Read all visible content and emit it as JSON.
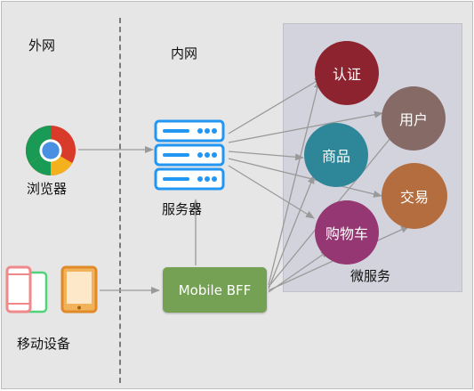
{
  "zones": {
    "external": "外网",
    "internal": "内网"
  },
  "clients": {
    "browser": "浏览器",
    "mobile": "移动设备"
  },
  "server": {
    "label": "服务器"
  },
  "bff": {
    "label": "Mobile BFF"
  },
  "microservices": {
    "label": "微服务",
    "auth": "认证",
    "user": "用户",
    "product": "商品",
    "trade": "交易",
    "cart": "购物车"
  },
  "colors": {
    "auth": "#8e2330",
    "user": "#856a66",
    "product": "#2e8699",
    "trade": "#b36d3f",
    "cart": "#953773",
    "bff": "#74a153",
    "server": "#2196f3",
    "arrow": "#9a9a9a"
  },
  "icons": {
    "browser": "chrome-icon",
    "server": "server-rack-icon",
    "phone": "phone-icon",
    "tablet": "tablet-icon"
  }
}
